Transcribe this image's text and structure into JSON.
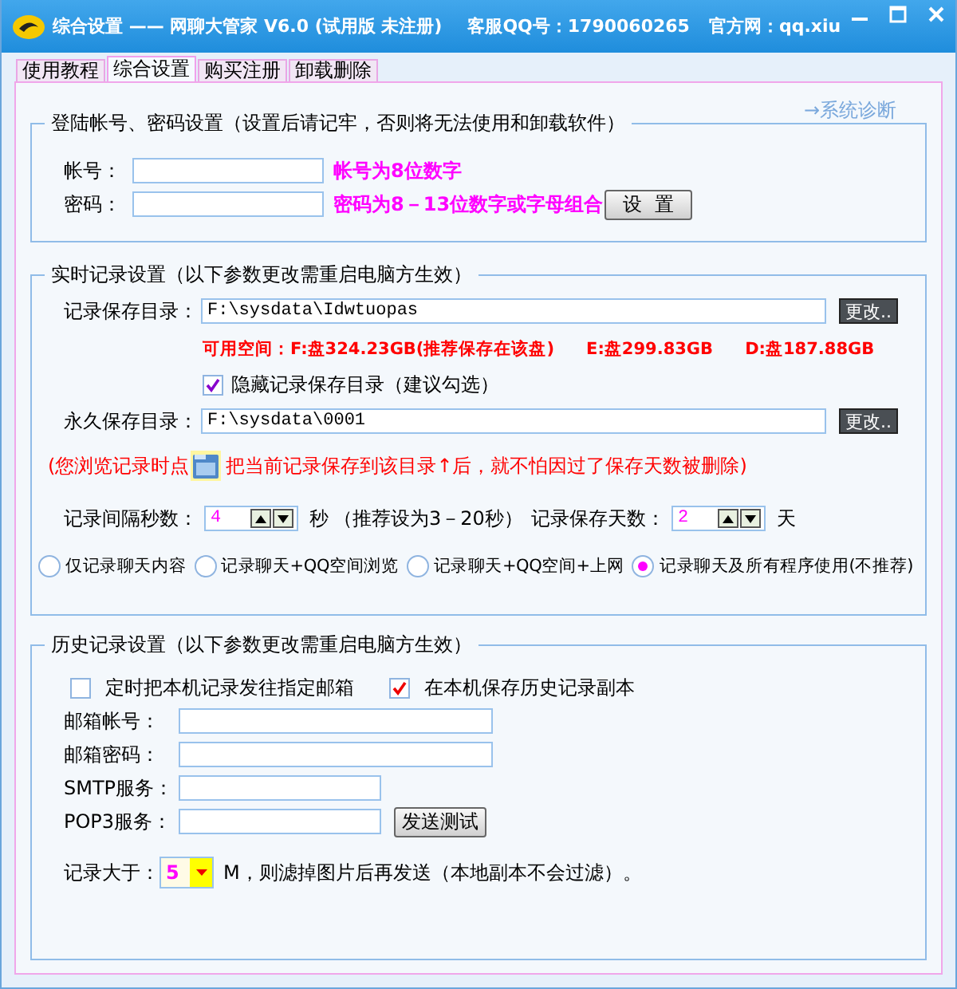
{
  "window": {
    "title": "综合设置 —— 网聊大管家 V6.0 (试用版 未注册)",
    "support": "客服QQ号：1790060265",
    "website": "官方网：qq.xiu"
  },
  "tabs": [
    {
      "label": "使用教程",
      "selected": false
    },
    {
      "label": "综合设置",
      "selected": true
    },
    {
      "label": "购买注册",
      "selected": false
    },
    {
      "label": "卸载删除",
      "selected": false
    }
  ],
  "diagnose_link": "→系统诊断",
  "login": {
    "legend": "登陆帐号、密码设置（设置后请记牢，否则将无法使用和卸载软件）",
    "fields": [
      {
        "label": "帐号：",
        "hint": "帐号为8位数字"
      },
      {
        "label": "密码：",
        "hint": "密码为8－13位数字或字母组合"
      }
    ],
    "button": "设  置"
  },
  "realtime": {
    "legend": "实时记录设置（以下参数更改需重启电脑方生效）",
    "save_dir": {
      "label": "记录保存目录：",
      "value": "F:\\sysdata\\Idwtuopas",
      "button": "更改.."
    },
    "space": [
      "可用空间：F:盘324.23GB(推荐保存在该盘)",
      "E:盘299.83GB",
      "D:盘187.88GB"
    ],
    "hide_dir": {
      "label": "隐藏记录保存目录（建议勾选）",
      "checked": true
    },
    "permanent_dir": {
      "label": "永久保存目录：",
      "value": "F:\\sysdata\\0001",
      "button": "更改.."
    },
    "note_before": "(您浏览记录时点",
    "note_after": "把当前记录保存到该目录↑后，就不怕因过了保存天数被删除)",
    "interval": {
      "label": "记录间隔秒数：",
      "value": "4",
      "unit": "秒",
      "hint": "（推荐设为3－20秒）"
    },
    "days": {
      "label": "记录保存天数：",
      "value": "2",
      "unit": "天"
    },
    "modes": [
      {
        "label": "仅记录聊天内容",
        "selected": false
      },
      {
        "label": "记录聊天+QQ空间浏览",
        "selected": false
      },
      {
        "label": "记录聊天+QQ空间+上网",
        "selected": false
      },
      {
        "label": "记录聊天及所有程序使用(不推荐)",
        "selected": true
      }
    ]
  },
  "history": {
    "legend": "历史记录设置（以下参数更改需重启电脑方生效）",
    "options": [
      {
        "label": "定时把本机记录发往指定邮箱",
        "checked": false
      },
      {
        "label": "在本机保存历史记录副本",
        "checked": true
      }
    ],
    "fields": [
      {
        "label": "邮箱帐号：",
        "kind": "wide"
      },
      {
        "label": "邮箱密码：",
        "kind": "wide"
      },
      {
        "label": "SMTP服务：",
        "kind": "short"
      },
      {
        "label": "POP3服务：",
        "kind": "short"
      }
    ],
    "test_button": "发送测试",
    "size": {
      "label": "记录大于：",
      "value": "5",
      "after": "M，则滤掉图片后再发送（本地副本不会过滤）。"
    }
  }
}
